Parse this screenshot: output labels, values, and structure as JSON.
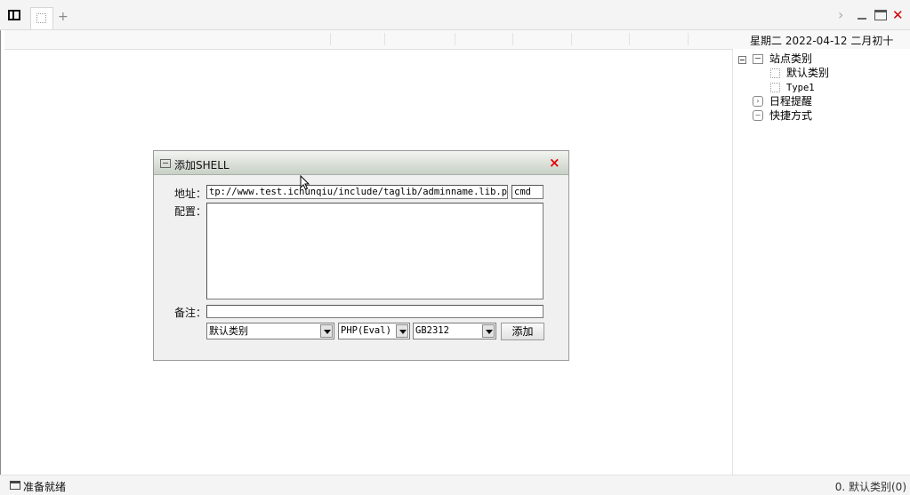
{
  "tabbar": {
    "add_tab": "+"
  },
  "header_date": "星期二 2022-04-12 二月初十",
  "sidebar": {
    "root": "站点类别",
    "categories": [
      "默认类别",
      "Type1"
    ],
    "schedule": "日程提醒",
    "shortcuts": "快捷方式"
  },
  "dialog": {
    "title": "添加SHELL",
    "close_label": "×",
    "address_label": "地址：",
    "address_value": "tp://www.test.ichunqiu/include/taglib/adminname.lib.php",
    "password_value": "cmd",
    "config_label": "配置：",
    "config_value": "",
    "note_label": "备注：",
    "note_value": "",
    "category_select": "默认类别",
    "type_select": "PHP(Eval)",
    "encoding_select": "GB2312",
    "add_button": "添加"
  },
  "statusbar": {
    "left": "准备就绪",
    "right": "0. 默认类别(0)"
  },
  "colors": {
    "close_red": "#e00000",
    "title_gradient_top": "#f2f4f0",
    "title_gradient_bottom": "#c8d0c6"
  },
  "icons": [
    "panel-toggle-icon",
    "tab-page-icon",
    "chevron-right-icon",
    "minimize-icon",
    "maximize-icon",
    "close-icon",
    "collapse-icon",
    "folder-icon",
    "schedule-icon",
    "shortcut-icon"
  ]
}
